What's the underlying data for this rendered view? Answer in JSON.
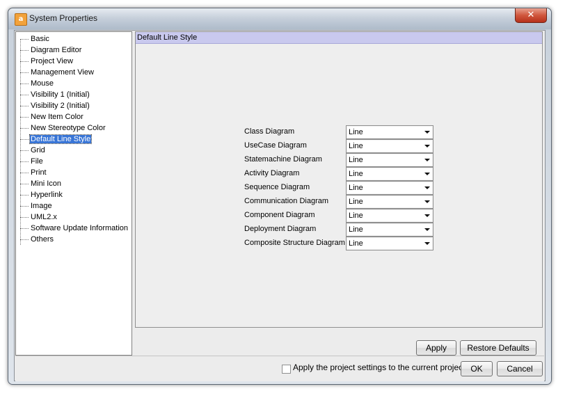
{
  "window": {
    "title": "System Properties",
    "app_icon_text": "a",
    "close_label": "✕"
  },
  "tree": {
    "items": [
      {
        "label": "Basic"
      },
      {
        "label": "Diagram Editor"
      },
      {
        "label": "Project View"
      },
      {
        "label": "Management View"
      },
      {
        "label": "Mouse"
      },
      {
        "label": "Visibility 1 (Initial)"
      },
      {
        "label": "Visibility 2 (Initial)"
      },
      {
        "label": "New Item Color"
      },
      {
        "label": "New Stereotype Color"
      },
      {
        "label": "Default Line Style",
        "selected": true
      },
      {
        "label": "Grid"
      },
      {
        "label": "File"
      },
      {
        "label": "Print"
      },
      {
        "label": "Mini Icon"
      },
      {
        "label": "Hyperlink"
      },
      {
        "label": "Image"
      },
      {
        "label": "UML2.x"
      },
      {
        "label": "Software Update Information"
      },
      {
        "label": "Others"
      }
    ]
  },
  "panel": {
    "title": "Default Line Style",
    "rows": [
      {
        "label": "Class Diagram",
        "value": "Line"
      },
      {
        "label": "UseCase Diagram",
        "value": "Line"
      },
      {
        "label": "Statemachine Diagram",
        "value": "Line"
      },
      {
        "label": "Activity Diagram",
        "value": "Line"
      },
      {
        "label": "Sequence Diagram",
        "value": "Line"
      },
      {
        "label": "Communication Diagram",
        "value": "Line"
      },
      {
        "label": "Component Diagram",
        "value": "Line"
      },
      {
        "label": "Deployment Diagram",
        "value": "Line"
      },
      {
        "label": "Composite Structure Diagram",
        "value": "Line"
      }
    ],
    "apply_label": "Apply",
    "restore_label": "Restore Defaults"
  },
  "footer": {
    "checkbox_label": "Apply the project settings to the current project",
    "checkbox_checked": false,
    "ok_label": "OK",
    "cancel_label": "Cancel"
  }
}
